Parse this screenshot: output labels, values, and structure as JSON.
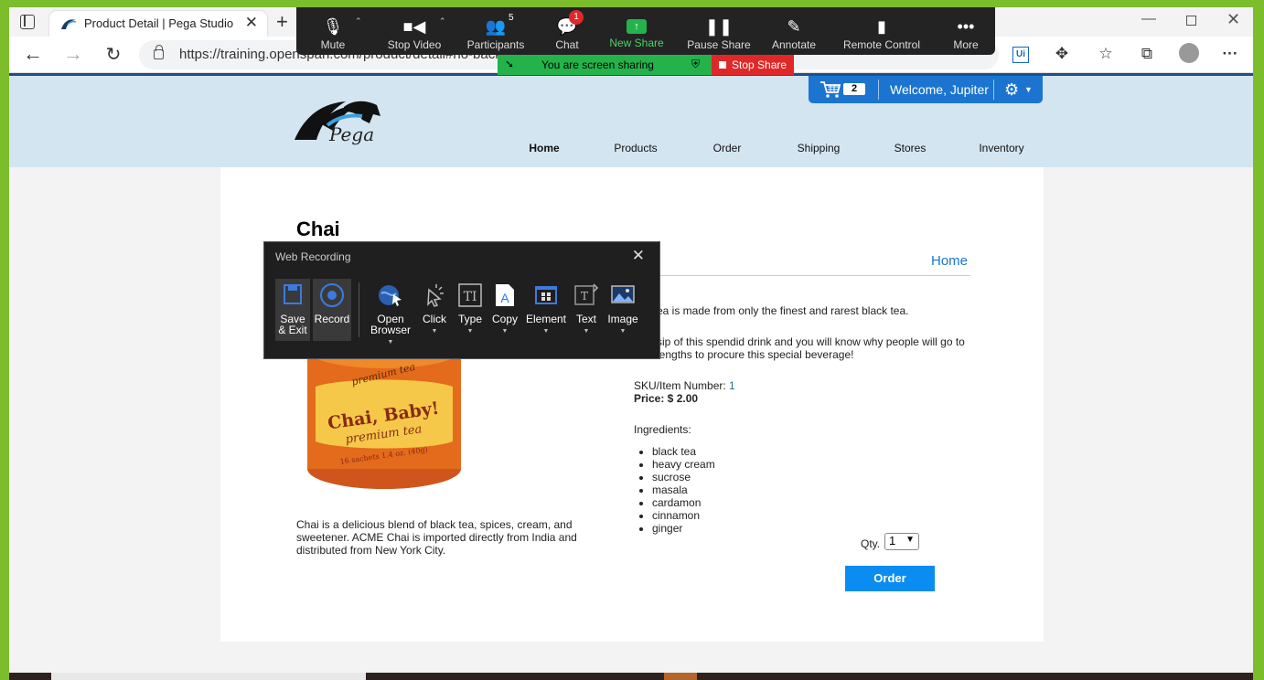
{
  "browser": {
    "tab_title": "Product Detail | Pega Studio Trai",
    "url": "https://training.openspan.com/product/detail#no-back",
    "new_tab_glyph": "+",
    "close_glyph": "✕"
  },
  "zoom": {
    "buttons": [
      {
        "label": "Mute",
        "icon": "microphone-icon"
      },
      {
        "label": "Stop Video",
        "icon": "video-camera-icon"
      },
      {
        "label": "Participants",
        "icon": "participants-icon"
      },
      {
        "label": "Chat",
        "icon": "chat-icon"
      },
      {
        "label": "New Share",
        "icon": "share-screen-icon"
      },
      {
        "label": "Pause Share",
        "icon": "pause-icon"
      },
      {
        "label": "Annotate",
        "icon": "pen-icon"
      },
      {
        "label": "Remote Control",
        "icon": "mouse-icon"
      },
      {
        "label": "More",
        "icon": "more-dots-icon"
      }
    ],
    "participant_count": "5",
    "chat_badge": "1",
    "sharing_banner": "You are screen sharing",
    "stop_share": "Stop Share"
  },
  "site": {
    "logo_text": "Pega",
    "cart_count": "2",
    "welcome": "Welcome, Jupiter",
    "nav": [
      "Home",
      "Products",
      "Order",
      "Shipping",
      "Stores",
      "Inventory"
    ],
    "nav_active": "Home"
  },
  "product": {
    "title": "Chai",
    "breadcrumb": "Home",
    "short_description": "Chai is a delicious blend of black tea, spices, cream, and sweetener. ACME Chai is imported directly from India and distributed from New York City.",
    "description_1": "ea is made from only the finest and rarest black tea.",
    "description_2": "sip of this spendid drink and you will know why people will go to lengths to procure this special beverage!",
    "sku_label": "SKU/Item Number: ",
    "sku_value": "1",
    "price": "Price: $ 2.00",
    "ingredients_label": "Ingredients:",
    "ingredients": [
      "black tea",
      "heavy cream",
      "sucrose",
      "masala",
      "cardamon",
      "cinnamon",
      "ginger"
    ],
    "qty_label": "Qty.",
    "qty_value": "1",
    "order_label": "Order",
    "image_text": "Chai, Baby! premium tea"
  },
  "web_recording": {
    "title": "Web Recording",
    "tools": [
      {
        "label": "Save & Exit",
        "icon": "save-icon"
      },
      {
        "label": "Record",
        "icon": "record-icon"
      },
      {
        "label": "Open Browser",
        "icon": "globe-cursor-icon"
      },
      {
        "label": "Click",
        "icon": "click-cursor-icon"
      },
      {
        "label": "Type",
        "icon": "type-icon"
      },
      {
        "label": "Copy",
        "icon": "copy-icon"
      },
      {
        "label": "Element",
        "icon": "element-icon"
      },
      {
        "label": "Text",
        "icon": "text-icon"
      },
      {
        "label": "Image",
        "icon": "image-icon"
      }
    ]
  },
  "colors": {
    "share_green": "#7cbd2c",
    "pega_blue": "#1b75d0",
    "order_blue": "#0a8cf0",
    "header_bg": "#d3e5f1",
    "stop_red": "#e02828"
  }
}
